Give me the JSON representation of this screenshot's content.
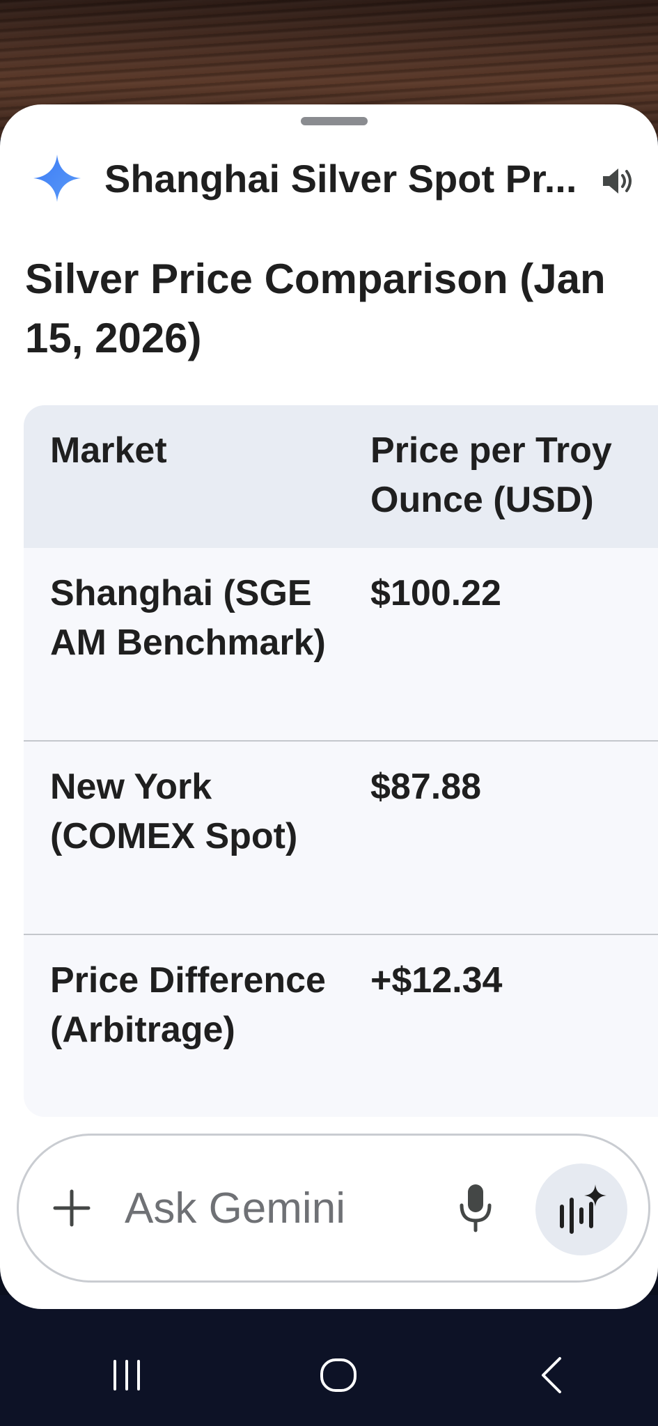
{
  "header": {
    "title": "Shanghai Silver Spot Pr..."
  },
  "content": {
    "heading": "Silver Price Comparison (Jan 15, 2026)",
    "table": {
      "columns": [
        "Market",
        "Price per Troy Ounce (USD)"
      ],
      "rows": [
        [
          "Shanghai (SGE AM Benchmark)",
          "$100.22"
        ],
        [
          "New York (COMEX Spot)",
          "$87.88"
        ],
        [
          "Price Difference (Arbitrage)",
          "+$12.34"
        ]
      ]
    }
  },
  "input": {
    "placeholder": "Ask Gemini"
  },
  "icons": {
    "gemini": "gemini-sparkle-icon",
    "speaker": "speaker-icon",
    "plus": "plus-icon",
    "mic": "microphone-icon",
    "live": "gemini-live-icon",
    "nav_recents": "recents-icon",
    "nav_home": "home-icon",
    "nav_back": "back-icon"
  },
  "colors": {
    "gemini_blue": "#4285f4",
    "table_header_bg": "#e8ecf3",
    "table_body_bg": "#f7f8fc"
  }
}
